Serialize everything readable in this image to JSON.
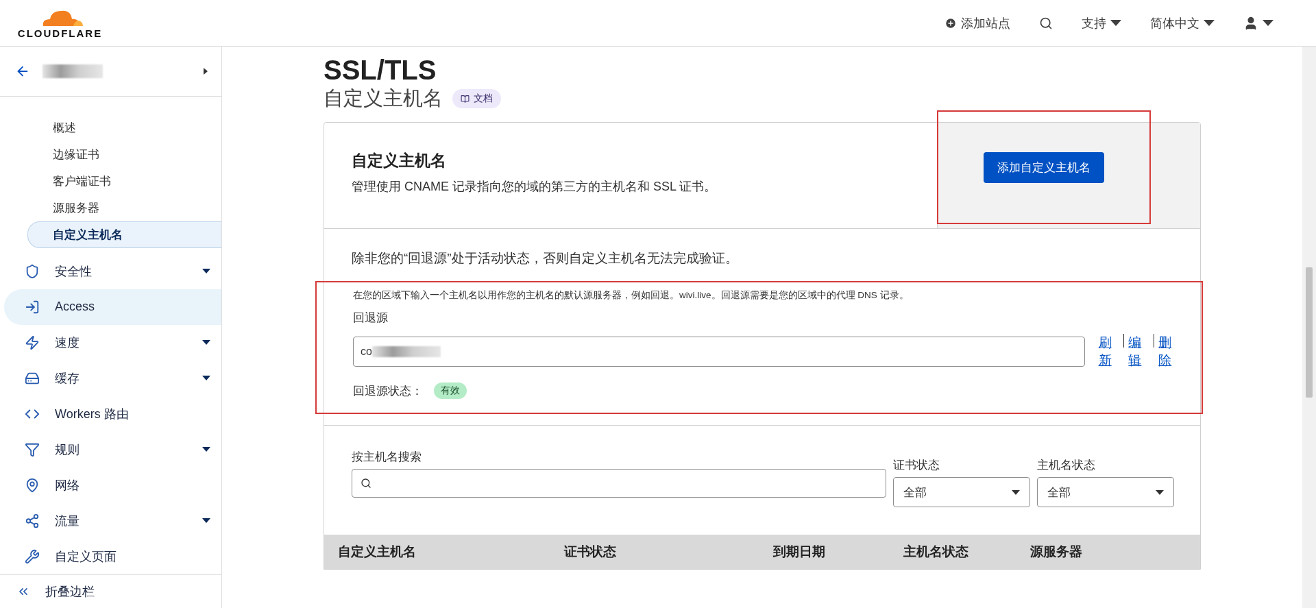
{
  "header": {
    "logo": "CLOUDFLARE",
    "nav": [
      {
        "kind": "add",
        "label": "添加站点"
      },
      {
        "kind": "search"
      },
      {
        "kind": "menu",
        "label": "支持"
      },
      {
        "kind": "menu",
        "label": "简体中文"
      },
      {
        "kind": "user"
      }
    ]
  },
  "sidebar": {
    "subitems": [
      {
        "label": "概述",
        "selected": false
      },
      {
        "label": "边缘证书",
        "selected": false
      },
      {
        "label": "客户端证书",
        "selected": false
      },
      {
        "label": "源服务器",
        "selected": false
      },
      {
        "label": "自定义主机名",
        "selected": true
      }
    ],
    "items": [
      {
        "label": "安全性",
        "expandable": true,
        "selected": false
      },
      {
        "label": "Access",
        "expandable": false,
        "selected": true
      },
      {
        "label": "速度",
        "expandable": true,
        "selected": false
      },
      {
        "label": "缓存",
        "expandable": true,
        "selected": false
      },
      {
        "label": "Workers 路由",
        "expandable": false,
        "selected": false
      },
      {
        "label": "规则",
        "expandable": true,
        "selected": false
      },
      {
        "label": "网络",
        "expandable": false,
        "selected": false
      },
      {
        "label": "流量",
        "expandable": true,
        "selected": false
      },
      {
        "label": "自定义页面",
        "expandable": false,
        "selected": false
      }
    ],
    "collapse": "折叠边栏"
  },
  "page": {
    "title": "SSL/TLS",
    "subtitle": "自定义主机名",
    "docs": "文档"
  },
  "intro": {
    "heading": "自定义主机名",
    "description": "管理使用 CNAME 记录指向您的域的第三方的主机名和 SSL 证书。",
    "button": "添加自定义主机名"
  },
  "fallback": {
    "warning": "除非您的“回退源”处于活动状态，否则自定义主机名无法完成验证。",
    "hint": "在您的区域下输入一个主机名以用作您的主机名的默认源服务器，例如回退。wivi.live。回退源需要是您的区域中的代理 DNS 记录。",
    "label": "回退源",
    "value": "co",
    "actions": [
      "刷新",
      "编辑",
      "删除"
    ],
    "status_label": "回退源状态：",
    "status": "有效"
  },
  "filters": {
    "search_label": "按主机名搜索",
    "selects": [
      {
        "label": "证书状态",
        "value": "全部"
      },
      {
        "label": "主机名状态",
        "value": "全部"
      }
    ]
  },
  "table": {
    "columns": [
      "自定义主机名",
      "证书状态",
      "到期日期",
      "主机名状态",
      "源服务器"
    ]
  }
}
